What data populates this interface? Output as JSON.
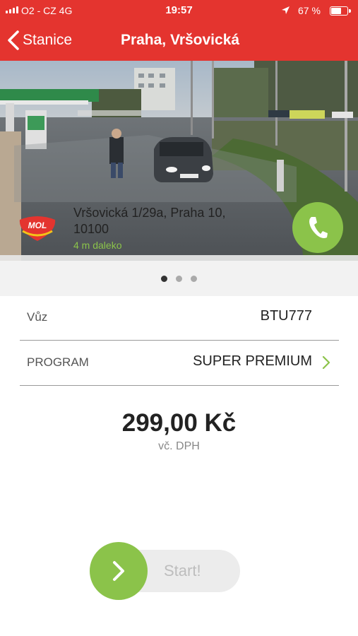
{
  "status_bar": {
    "carrier": "O2 - CZ  4G",
    "time": "19:57",
    "battery": "67 %"
  },
  "nav": {
    "back_label": "Stanice",
    "title": "Praha, Vršovická"
  },
  "station": {
    "address": "Vršovická 1/29a, Praha 10, 10100",
    "distance": "4 m daleko",
    "logo_text": "MOL",
    "photo_pages": 3,
    "active_page": 1
  },
  "form": {
    "car_label": "Vůz",
    "car_value": "BTU777",
    "program_label": "PROGRAM",
    "program_value": "SUPER PREMIUM"
  },
  "price": {
    "amount": "299,00 Kč",
    "vat_note": "vč. DPH"
  },
  "start": {
    "label": "Start!"
  },
  "colors": {
    "brand_red": "#e4342f",
    "accent_green": "#8bc34a"
  },
  "icons": [
    "signal-icon",
    "location-arrow-icon",
    "battery-icon",
    "chevron-left-icon",
    "phone-icon",
    "chevron-right-icon"
  ]
}
